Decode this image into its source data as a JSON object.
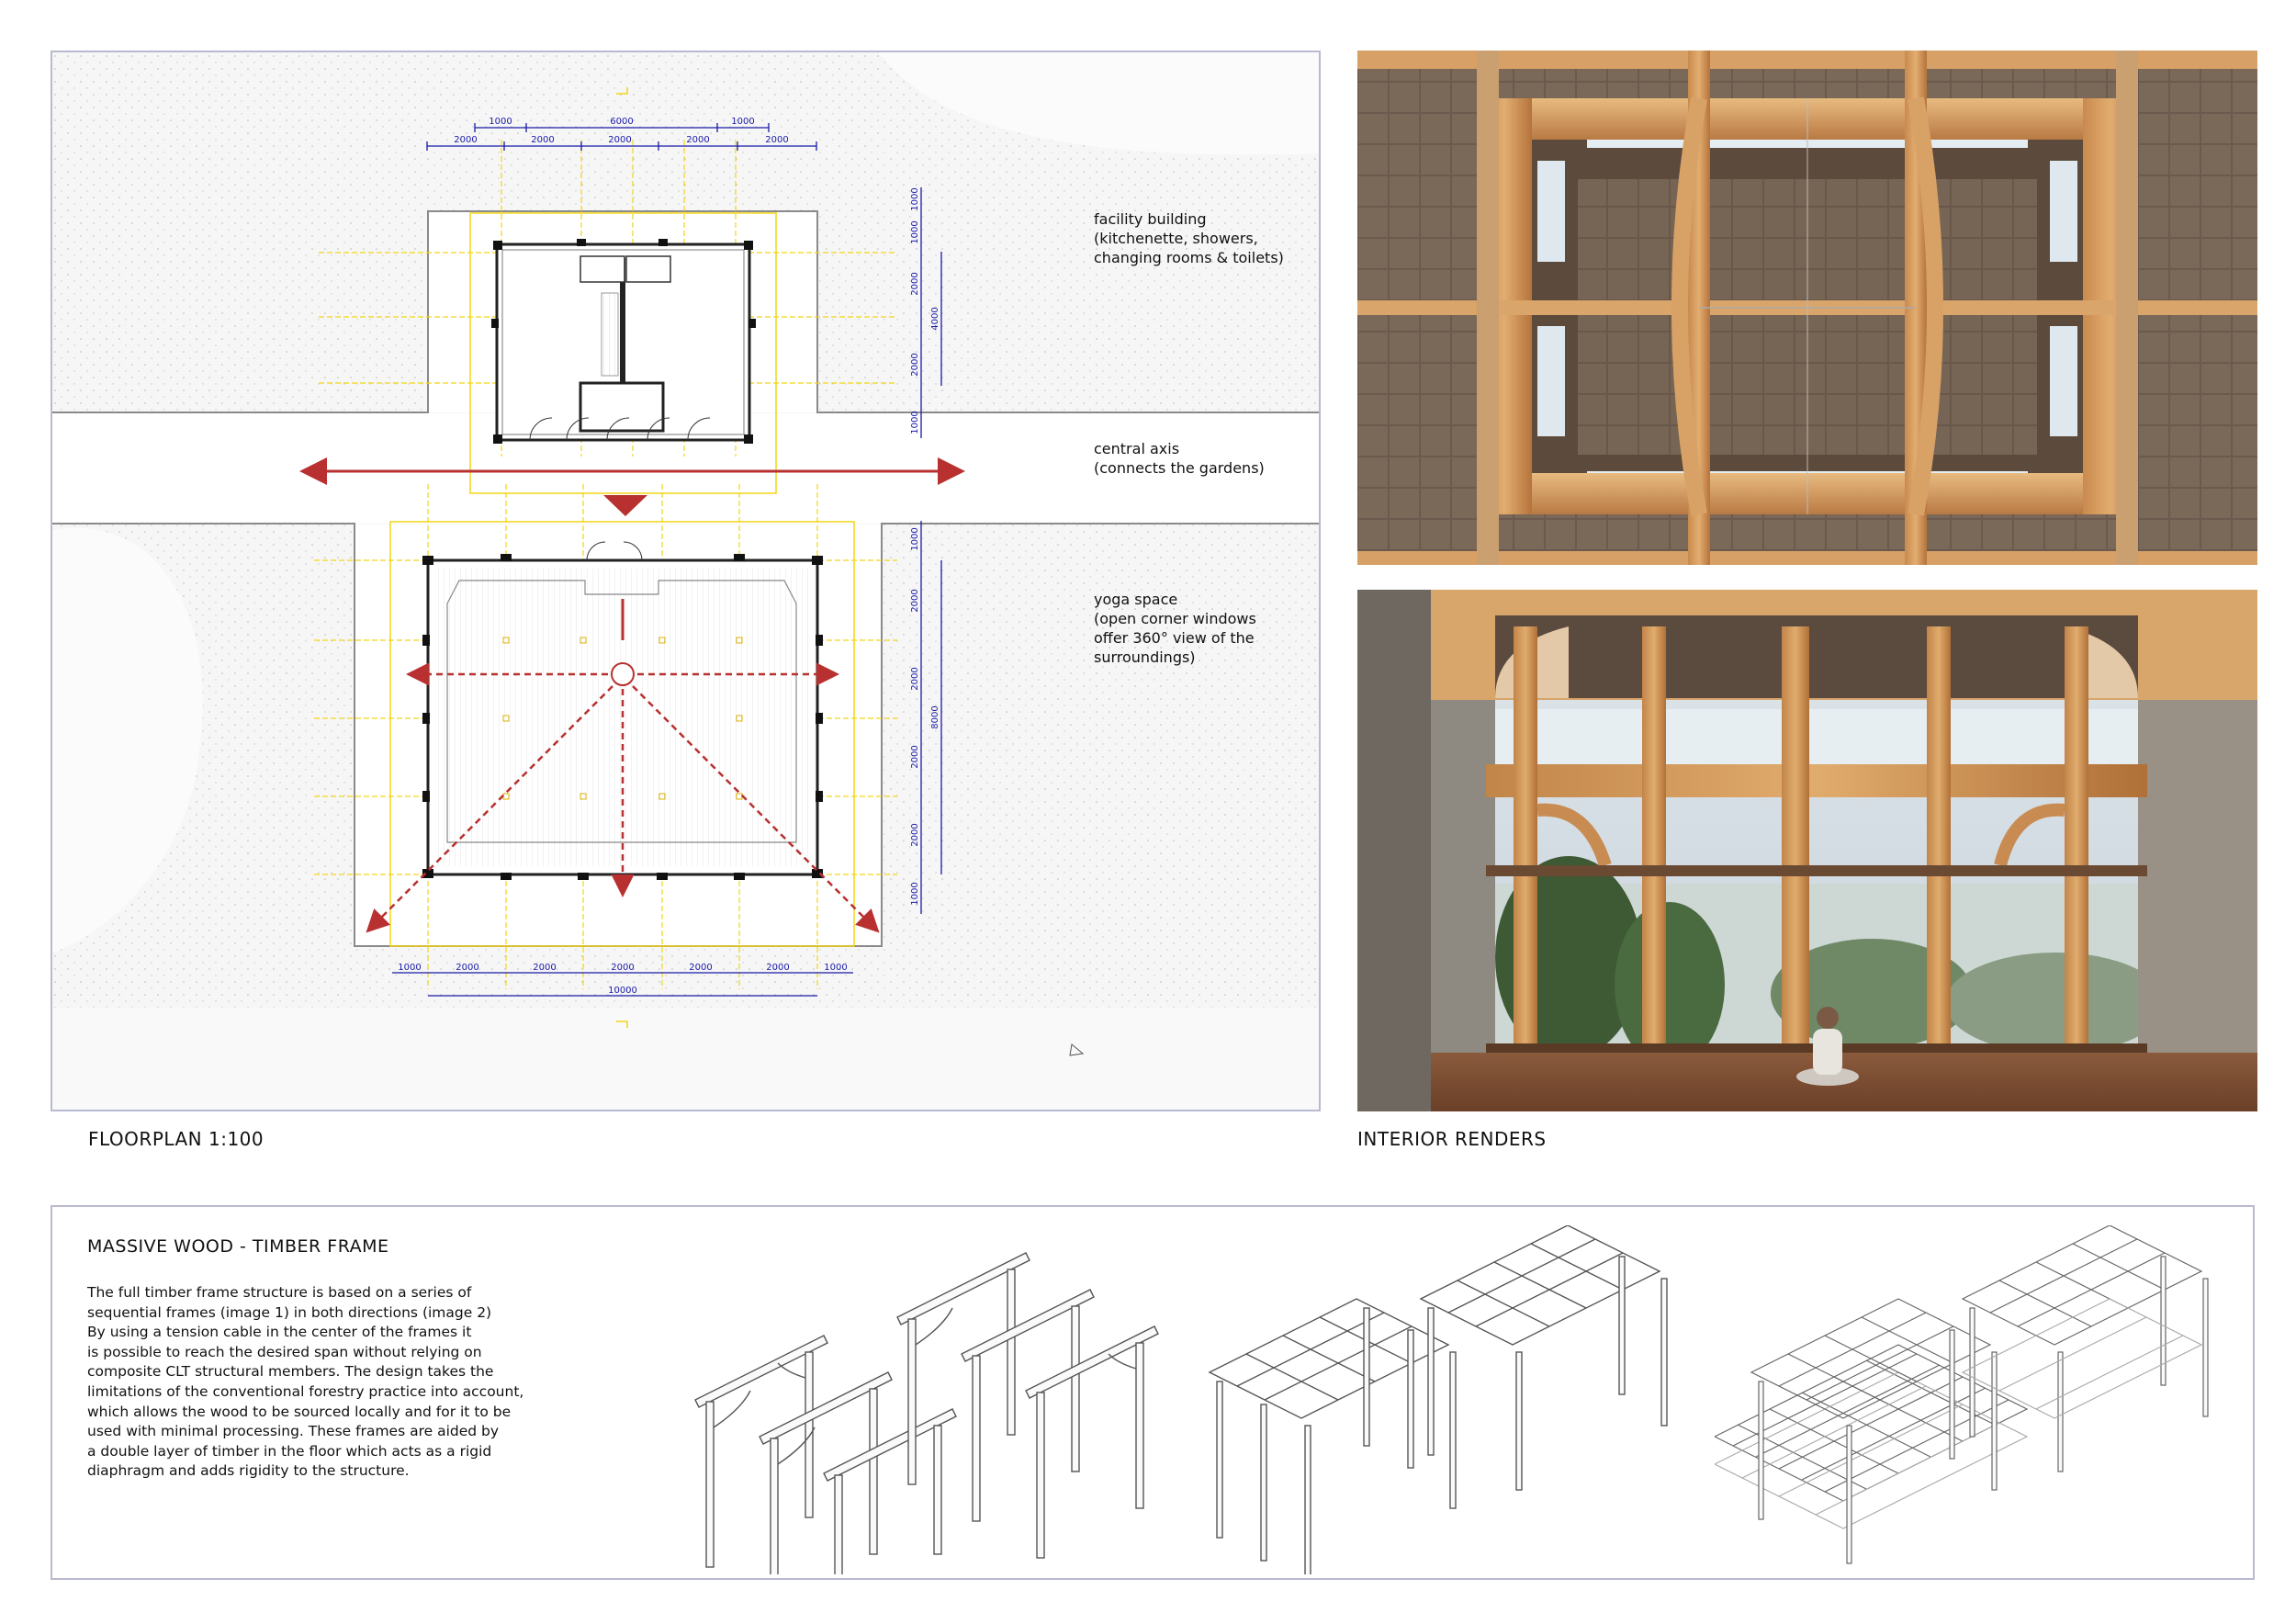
{
  "floorplan": {
    "caption": "FLOORPLAN 1:100",
    "dims_top_row1": [
      "1000",
      "6000",
      "1000"
    ],
    "dims_top_row2": [
      "2000",
      "2000",
      "2000",
      "2000",
      "2000"
    ],
    "dims_right_upper": [
      "1000",
      "1000",
      "2000",
      "2000",
      "1000"
    ],
    "dim_right_upper_total": "4000",
    "dims_right_lower": [
      "1000",
      "2000",
      "2000",
      "2000",
      "2000",
      "1000"
    ],
    "dim_right_lower_total": "8000",
    "dims_bottom_row1": [
      "1000",
      "2000",
      "2000",
      "2000",
      "2000",
      "2000",
      "1000"
    ],
    "dim_bottom_total": "10000",
    "notes": {
      "facility": "facility building\n(kitchenette, showers,\nchanging rooms & toilets)",
      "axis": "central axis\n(connects the gardens)",
      "yoga": "yoga space\n(open corner windows\noffer 360° view of the\nsurroundings)"
    },
    "colors": {
      "dimension_blue": "#1a1aa8",
      "grid_yellow": "#f2d516",
      "axis_red": "#b83030",
      "wall_grey": "#8a8a8a"
    }
  },
  "renders": {
    "caption": "INTERIOR RENDERS",
    "ceiling_alt": "ceiling view render",
    "interior_alt": "yoga space interior render"
  },
  "timber_frame": {
    "title": "MASSIVE WOOD - TIMBER FRAME",
    "lines": [
      "The full timber frame structure is based on a series of",
      "sequential frames (image 1) in both directions (image 2)",
      "By using a tension cable in the center of the frames it",
      "is possible to reach the desired span without relying on",
      "composite CLT structural members. The design takes the",
      "limitations of the conventional forestry practice into account,",
      "which allows the wood to be sourced locally and for it to be",
      "used with minimal processing. These frames are aided by",
      "a double layer of timber in the floor which acts as a rigid",
      "diaphragm and adds rigidity to the structure."
    ]
  }
}
